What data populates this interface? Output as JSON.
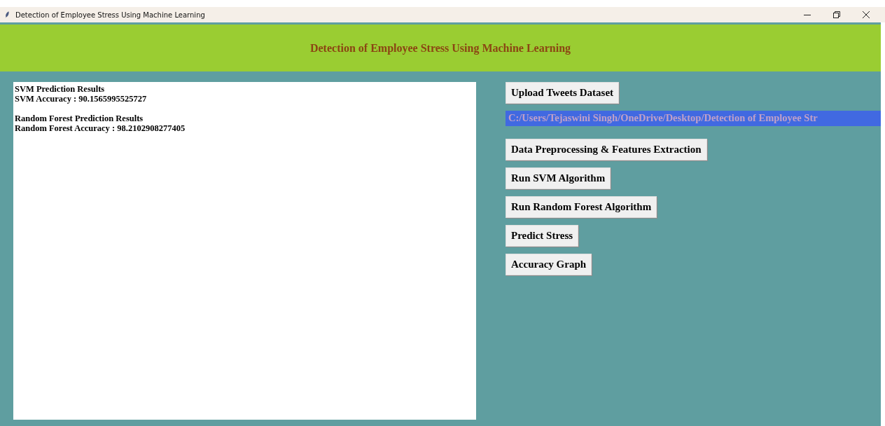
{
  "window": {
    "title": "Detection of Employee Stress Using Machine Learning"
  },
  "header": {
    "title": "Detection of Employee Stress Using Machine Learning"
  },
  "output_blocks": [
    [
      "SVM Prediction Results",
      "SVM Accuracy : 90.1565995525727"
    ],
    [
      "Random Forest Prediction Results",
      "Random Forest Accuracy : 98.2102908277405"
    ]
  ],
  "controls": [
    {
      "kind": "button",
      "label": "Upload Tweets Dataset"
    },
    {
      "kind": "path",
      "label": "C:/Users/Tejaswini Singh/OneDrive/Desktop/Detection of Employee Str"
    },
    {
      "kind": "button",
      "label": "Data Preprocessing & Features Extraction"
    },
    {
      "kind": "button",
      "label": "Run SVM Algorithm"
    },
    {
      "kind": "button",
      "label": "Run Random Forest Algorithm"
    },
    {
      "kind": "button",
      "label": "Predict Stress"
    },
    {
      "kind": "button",
      "label": "Accuracy Graph"
    }
  ]
}
